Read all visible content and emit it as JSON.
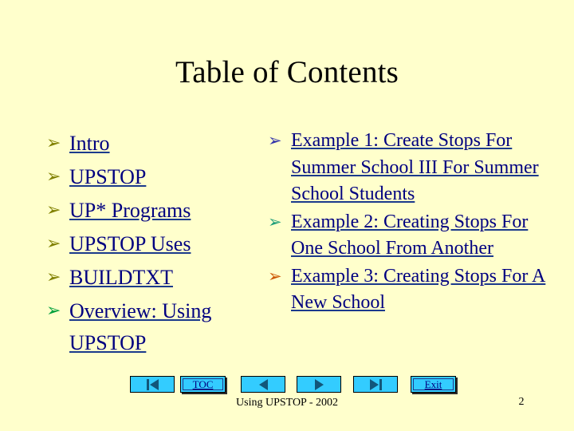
{
  "slide": {
    "title": "Table of Contents",
    "background_color": "#ffffcc",
    "link_color": "#000080"
  },
  "left_column": {
    "items": [
      {
        "bullet": "➢",
        "bullet_color": "#808000",
        "label": "Intro"
      },
      {
        "bullet": "➢",
        "bullet_color": "#808000",
        "label": "UPSTOP"
      },
      {
        "bullet": "➢",
        "bullet_color": "#808000",
        "label": "UP* Programs"
      },
      {
        "bullet": "➢",
        "bullet_color": "#808000",
        "label": "UPSTOP Uses"
      },
      {
        "bullet": "➢",
        "bullet_color": "#808000",
        "label": "BUILDTXT"
      },
      {
        "bullet": "➢",
        "bullet_color": "#00a03c",
        "label": "Overview: Using UPSTOP"
      }
    ]
  },
  "right_column": {
    "items": [
      {
        "bullet": "➢",
        "bullet_color": "#3333aa",
        "label": "Example 1: Create Stops For Summer School III For Summer School Students"
      },
      {
        "bullet": "➢",
        "bullet_color": "#1f9e7a",
        "label": "Example 2: Creating Stops For One School From Another"
      },
      {
        "bullet": "➢",
        "bullet_color": "#cc5500",
        "label": "Example 3: Creating Stops For A New School"
      }
    ]
  },
  "navbar": {
    "buttons": [
      {
        "name": "first-slide",
        "icon": "first-slide-icon",
        "label": ""
      },
      {
        "name": "toc",
        "icon": "",
        "label": "TOC"
      },
      {
        "name": "previous-slide",
        "icon": "previous-slide-icon",
        "label": ""
      },
      {
        "name": "next-slide",
        "icon": "next-slide-icon",
        "label": ""
      },
      {
        "name": "last-slide",
        "icon": "last-slide-icon",
        "label": ""
      },
      {
        "name": "exit",
        "icon": "",
        "label": "Exit"
      }
    ],
    "toc_label": "TOC",
    "exit_label": "Exit",
    "button_color": "#33ccff"
  },
  "footer": {
    "text": "Using UPSTOP - 2002",
    "page_number": "2"
  }
}
